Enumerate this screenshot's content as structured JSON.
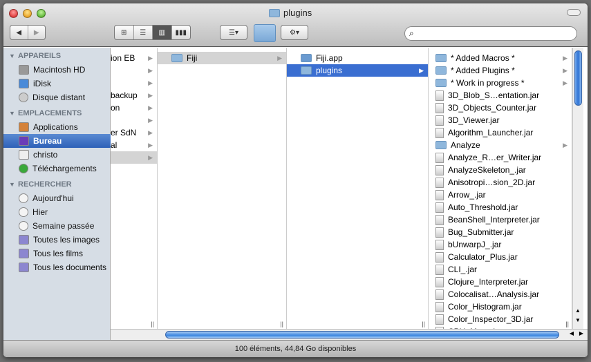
{
  "window": {
    "title": "plugins"
  },
  "toolbar": {
    "back": "◀",
    "forward": "▶",
    "views": [
      "⊞",
      "☰",
      "▥",
      "▮▮▮"
    ],
    "arrange": "☰▾",
    "action": "⚙▾",
    "search_placeholder": ""
  },
  "sidebar": {
    "sections": [
      {
        "label": "APPAREILS",
        "items": [
          {
            "label": "Macintosh HD",
            "icon": "hard-drive-icon"
          },
          {
            "label": "iDisk",
            "icon": "idisk-icon"
          },
          {
            "label": "Disque distant",
            "icon": "disc-icon"
          }
        ]
      },
      {
        "label": "EMPLACEMENTS",
        "items": [
          {
            "label": "Applications",
            "icon": "applications-icon"
          },
          {
            "label": "Bureau",
            "icon": "desktop-icon",
            "selected": true
          },
          {
            "label": "christo",
            "icon": "home-icon"
          },
          {
            "label": "Téléchargements",
            "icon": "downloads-icon"
          }
        ]
      },
      {
        "label": "RECHERCHER",
        "items": [
          {
            "label": "Aujourd'hui",
            "icon": "clock-icon"
          },
          {
            "label": "Hier",
            "icon": "clock-icon"
          },
          {
            "label": "Semaine passée",
            "icon": "clock-icon"
          },
          {
            "label": "Toutes les images",
            "icon": "smart-folder-icon"
          },
          {
            "label": "Tous les films",
            "icon": "smart-folder-icon"
          },
          {
            "label": "Tous les documents",
            "icon": "smart-folder-icon"
          }
        ]
      }
    ]
  },
  "columns": {
    "col1": [
      "ion EB",
      "",
      "",
      "backup",
      "on",
      "",
      "er SdN",
      "al",
      ""
    ],
    "col2": [
      "Fiji"
    ],
    "col3": [
      "Fiji.app",
      "plugins"
    ],
    "col4": [
      {
        "n": "* Added Macros *",
        "f": 1
      },
      {
        "n": "* Added Plugins *",
        "f": 1
      },
      {
        "n": "* Work in progress *",
        "f": 1
      },
      {
        "n": "3D_Blob_S…entation.jar"
      },
      {
        "n": "3D_Objects_Counter.jar"
      },
      {
        "n": "3D_Viewer.jar"
      },
      {
        "n": "Algorithm_Launcher.jar"
      },
      {
        "n": "Analyze",
        "f": 1
      },
      {
        "n": "Analyze_R…er_Writer.jar"
      },
      {
        "n": "AnalyzeSkeleton_.jar"
      },
      {
        "n": "Anisotropi…sion_2D.jar"
      },
      {
        "n": "Arrow_.jar"
      },
      {
        "n": "Auto_Threshold.jar"
      },
      {
        "n": "BeanShell_Interpreter.jar"
      },
      {
        "n": "Bug_Submitter.jar"
      },
      {
        "n": "bUnwarpJ_.jar"
      },
      {
        "n": "Calculator_Plus.jar"
      },
      {
        "n": "CLI_.jar"
      },
      {
        "n": "Clojure_Interpreter.jar"
      },
      {
        "n": "Colocalisat…Analysis.jar"
      },
      {
        "n": "Color_Histogram.jar"
      },
      {
        "n": "Color_Inspector_3D.jar"
      },
      {
        "n": "CPU_Meter.jar"
      }
    ]
  },
  "status": {
    "text": "100 éléments, 44,84 Go disponibles"
  },
  "colors": {
    "selection": "#3a6ed1",
    "sidebar": "#d6dde5"
  }
}
